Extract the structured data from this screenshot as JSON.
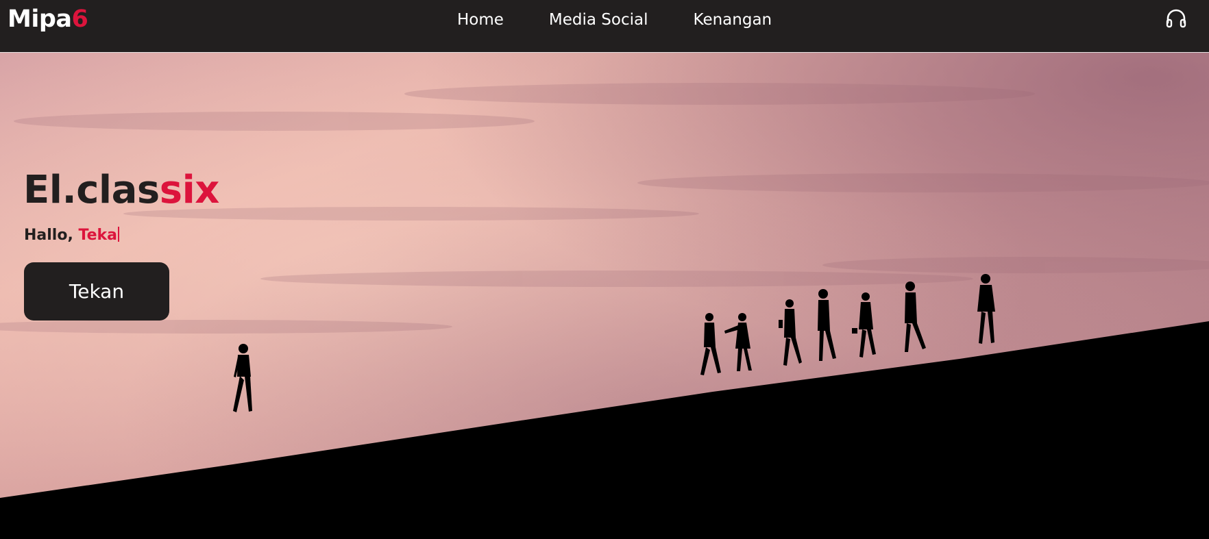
{
  "brand": {
    "name": "Mipa",
    "suffix": "6",
    "accent_color": "#dc143c"
  },
  "nav": {
    "items": [
      {
        "label": "Home"
      },
      {
        "label": "Media Social"
      },
      {
        "label": "Kenangan"
      }
    ],
    "audio_icon": "headphones-icon"
  },
  "hero": {
    "title_main": "El.clas",
    "title_accent": "six",
    "greeting_prefix": "Hallo, ",
    "greeting_typed": "Teka",
    "button_label": "Tekan",
    "background": "sunset-sky-with-silhouettes-walking-uphill"
  },
  "colors": {
    "navbar_bg": "#221f1f",
    "accent": "#dc143c",
    "button_bg": "#221f1f"
  }
}
